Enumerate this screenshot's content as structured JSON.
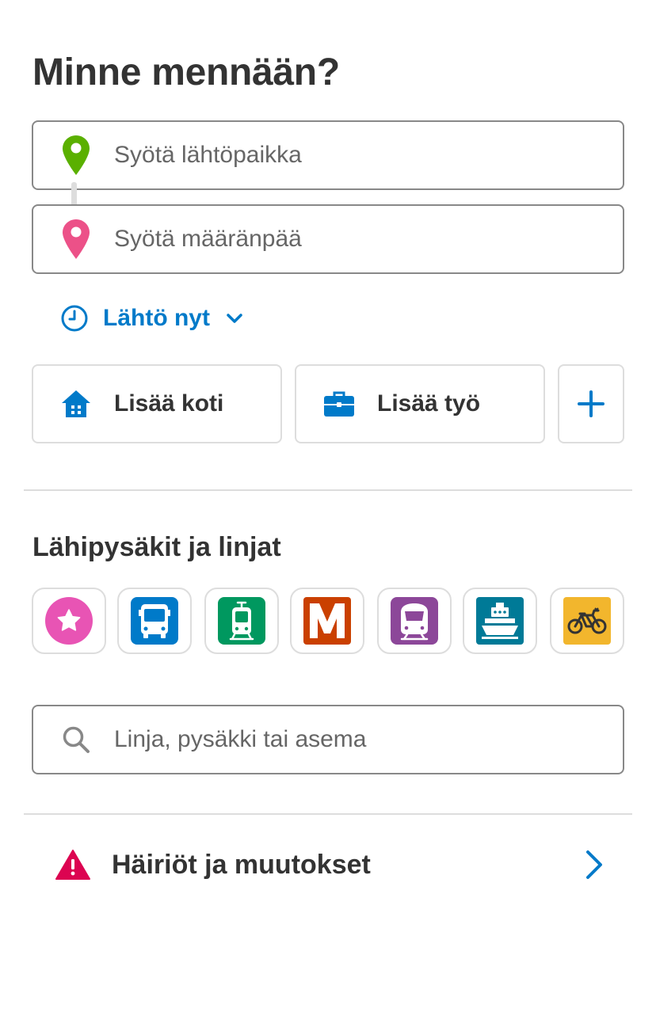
{
  "header": {
    "title": "Minne mennään?"
  },
  "search_form": {
    "origin_placeholder": "Syötä lähtöpaikka",
    "destination_placeholder": "Syötä määränpää",
    "time_selector_label": "Lähtö nyt"
  },
  "quick_links": {
    "home_label": "Lisää koti",
    "work_label": "Lisää työ"
  },
  "nearby": {
    "title": "Lähipysäkit ja linjat",
    "modes": [
      {
        "name": "favourites",
        "icon": "star-icon",
        "color": "#e854b4"
      },
      {
        "name": "bus",
        "icon": "bus-icon",
        "color": "#007ac9"
      },
      {
        "name": "tram",
        "icon": "tram-icon",
        "color": "#00985f"
      },
      {
        "name": "metro",
        "icon": "metro-icon",
        "color": "#ca4000"
      },
      {
        "name": "train",
        "icon": "train-icon",
        "color": "#8c4799"
      },
      {
        "name": "ferry",
        "icon": "ferry-icon",
        "color": "#007a97"
      },
      {
        "name": "citybike",
        "icon": "citybike-icon",
        "color": "#f2b62d"
      }
    ],
    "search_placeholder": "Linja, pysäkki tai asema"
  },
  "alerts": {
    "label": "Häiriöt ja muutokset"
  },
  "colors": {
    "accent": "#007ac9",
    "origin_pin": "#5ab000",
    "destination_pin": "#ec5188",
    "alert": "#dc0451"
  }
}
